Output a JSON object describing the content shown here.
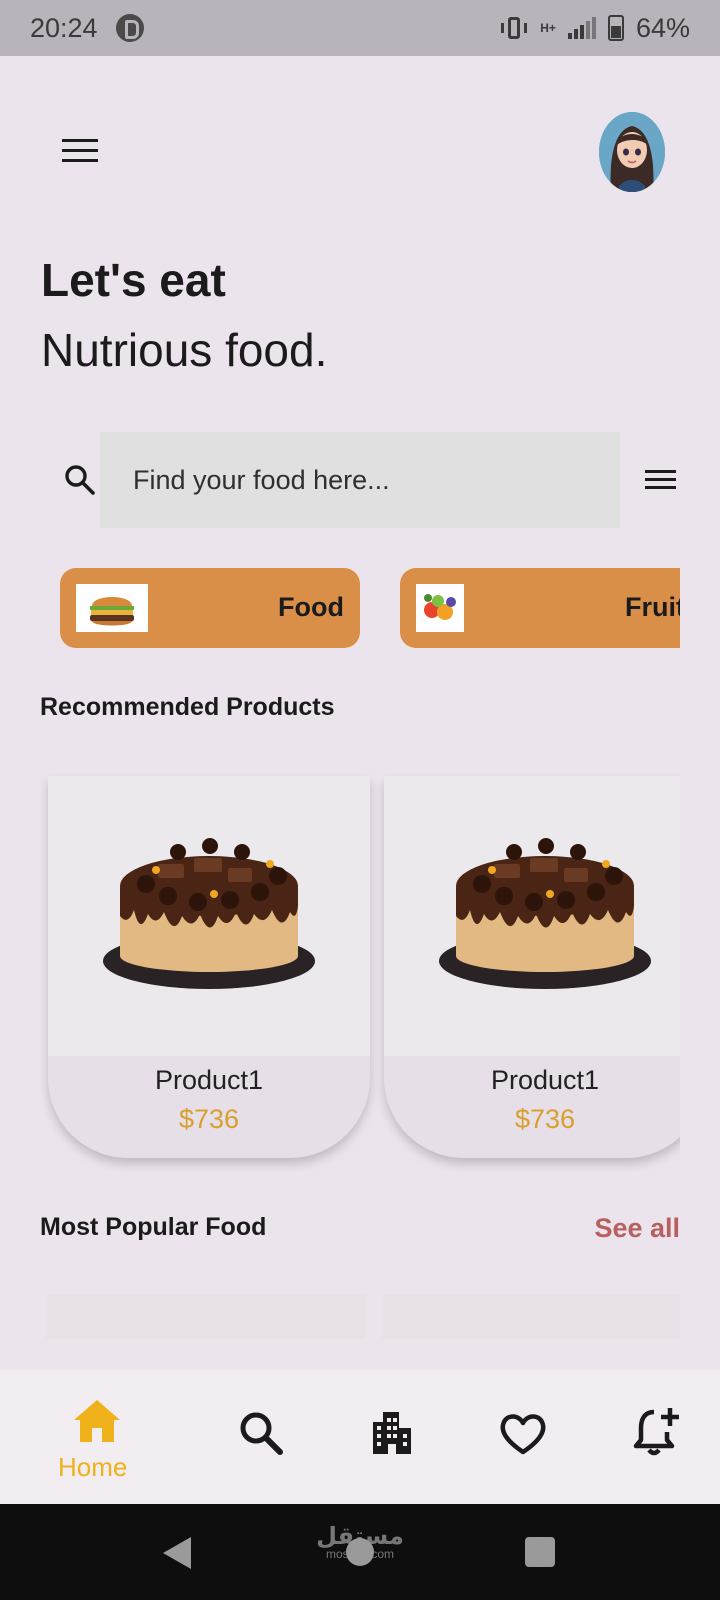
{
  "status_bar": {
    "time": "20:24",
    "network": "H+",
    "battery_percent": "64%",
    "battery_level": 0.64,
    "icons": [
      "app-notification-icon",
      "vibrate-icon",
      "signal-icon",
      "battery-icon"
    ]
  },
  "header": {
    "menu_icon": "menu-icon",
    "avatar": "user-avatar"
  },
  "hero": {
    "line1": "Let's eat",
    "line2": "Nutrious food."
  },
  "search": {
    "placeholder": "Find your food here...",
    "value": "",
    "search_icon": "search-icon",
    "filter_icon": "filter-menu-icon"
  },
  "categories": [
    {
      "label": "Food",
      "image": "burger-image"
    },
    {
      "label": "Fruit",
      "image": "fruits-image"
    }
  ],
  "recommended": {
    "title": "Recommended Products",
    "products": [
      {
        "name": "Product1",
        "price": "$736",
        "image": "chocolate-cake-image"
      },
      {
        "name": "Product1",
        "price": "$736",
        "image": "chocolate-cake-image"
      }
    ]
  },
  "popular": {
    "title": "Most Popular Food",
    "see_all": "See all"
  },
  "bottom_nav": {
    "items": [
      {
        "label": "Home",
        "icon": "home-icon",
        "active": true
      },
      {
        "label": "",
        "icon": "search-icon",
        "active": false
      },
      {
        "label": "",
        "icon": "buildings-icon",
        "active": false
      },
      {
        "label": "",
        "icon": "heart-icon",
        "active": false
      },
      {
        "label": "",
        "icon": "notification-add-icon",
        "active": false
      }
    ],
    "active_color": "#F0B21A",
    "inactive_color": "#1B1B1B"
  },
  "system_nav": {
    "watermark": "مستقل",
    "watermark_sub": "mostaql.com"
  },
  "colors": {
    "background": "#ECE4EC",
    "chip": "#DA8F48",
    "price": "#D9A02E",
    "see_all": "#B86060"
  }
}
